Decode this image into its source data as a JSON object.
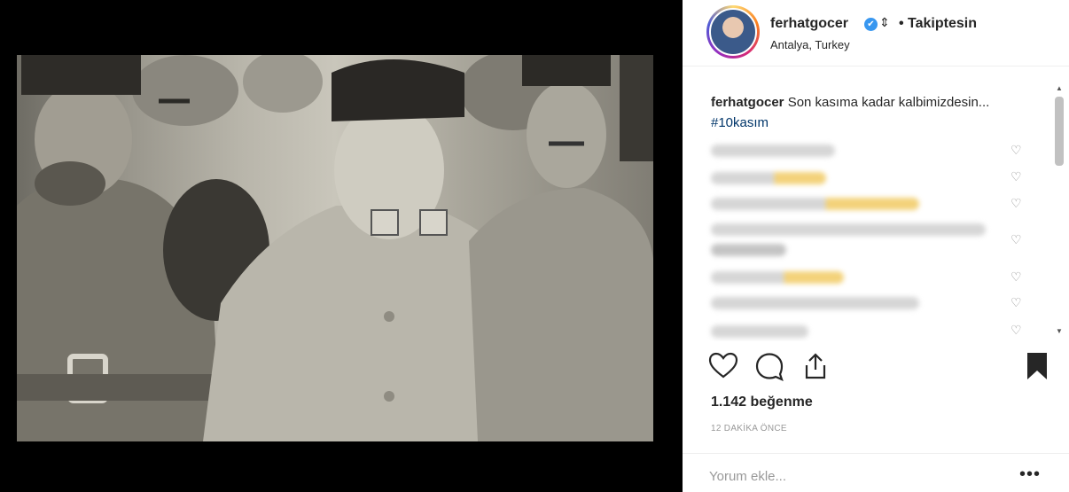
{
  "post": {
    "username": "ferhatgocer",
    "verified_icon": "✔",
    "follow_status": "• Takiptesin",
    "location": "Antalya, Turkey"
  },
  "caption": {
    "username": "ferhatgocer",
    "text": "Son kasıma kadar kalbimizdesin...",
    "hashtag": "#10kasım"
  },
  "stats": {
    "likes": "1.142 beğenme",
    "time": "12 DAKİKA ÖNCE"
  },
  "comment_box": {
    "placeholder": "Yorum ekle..."
  },
  "icons": {
    "more": "•••",
    "heart_small": "♡",
    "scroll_up": "▲",
    "scroll_down": "▼"
  },
  "colors": {
    "verified": "#3897f0",
    "hashtag": "#003569",
    "text": "#262626",
    "muted": "#999999"
  }
}
